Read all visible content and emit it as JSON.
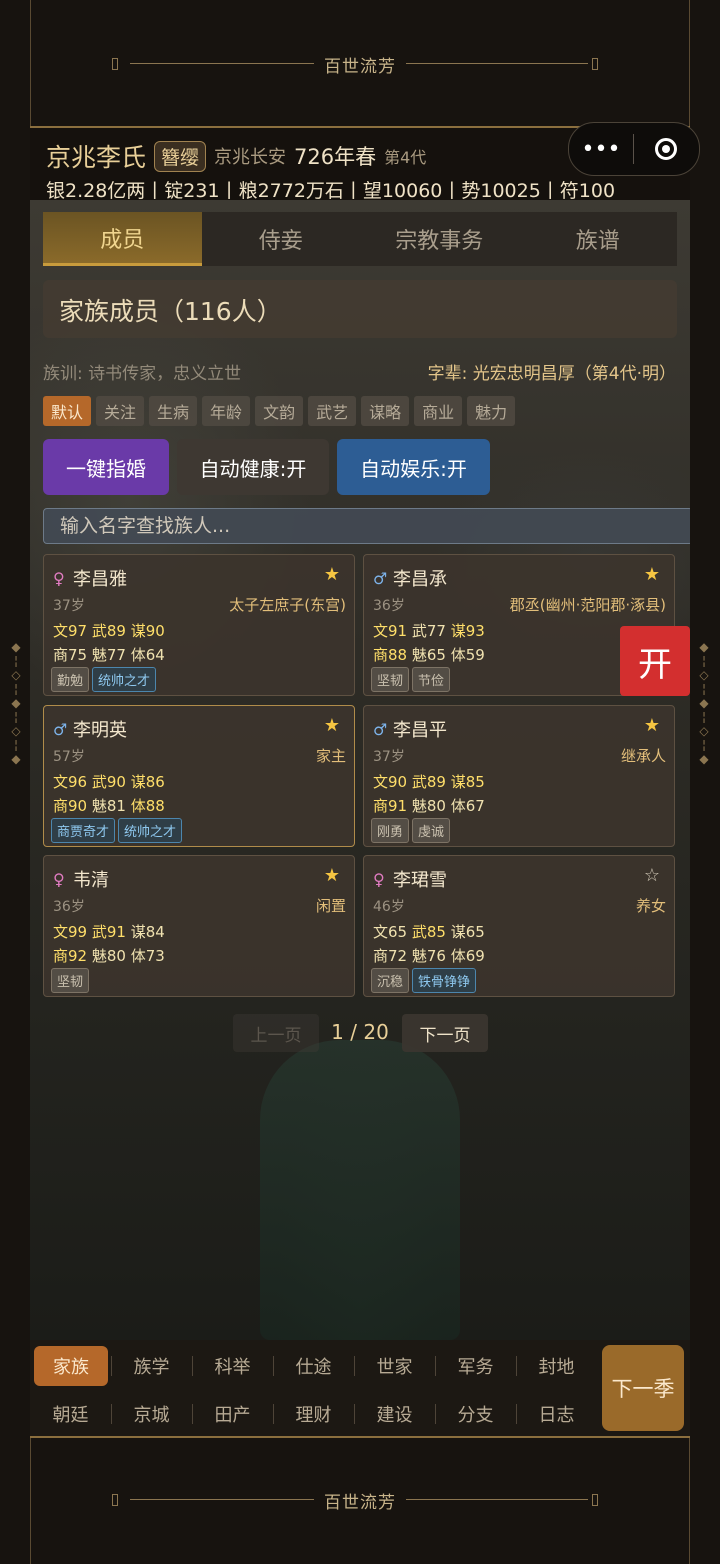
{
  "banner_top": "百世流芳",
  "banner_bottom": "百世流芳",
  "header": {
    "clan": "京兆李氏",
    "rank": "簪缨",
    "place": "京兆长安",
    "year": "726年春",
    "generation": "第4代",
    "resources": "银2.28亿两丨锭231丨粮2772万石丨望10060丨势10025丨符100"
  },
  "capsule": {
    "more_icon": "more-dots-icon",
    "close_icon": "target-icon"
  },
  "tabs": [
    "成员",
    "侍妾",
    "宗教事务",
    "族谱"
  ],
  "section_title": "家族成员（116人）",
  "motto": "族训: 诗书传家，忠义立世",
  "generation_names": "字辈: 光宏忠明昌厚（第4代·明）",
  "sort_chips": [
    "默认",
    "关注",
    "生病",
    "年龄",
    "文韵",
    "武艺",
    "谋略",
    "商业",
    "魅力"
  ],
  "actions": {
    "marry": "一键指婚",
    "health": "自动健康:开",
    "fun": "自动娱乐:开"
  },
  "search_placeholder": "输入名字查找族人...",
  "members": [
    {
      "sex": "♀",
      "name": "李昌雅",
      "star": "★",
      "age": "37岁",
      "role": "太子左庶子(东宫)",
      "wen": "文97",
      "wu": "武89",
      "mou": "谋90",
      "shang": "商75",
      "mei": "魅77",
      "ti": "体64",
      "traits": [
        "勤勉",
        "统帅之才"
      ]
    },
    {
      "sex": "♂",
      "name": "李昌承",
      "star": "★",
      "age": "36岁",
      "role": "郡丞(幽州·范阳郡·涿县)",
      "wen": "文91",
      "wu": "武77",
      "mou": "谋93",
      "shang": "商88",
      "mei": "魅65",
      "ti": "体59",
      "traits": [
        "坚韧",
        "节俭"
      ]
    },
    {
      "sex": "♂",
      "name": "李明英",
      "star": "★",
      "age": "57岁",
      "role": "家主",
      "wen": "文96",
      "wu": "武90",
      "mou": "谋86",
      "shang": "商90",
      "mei": "魅81",
      "ti": "体88",
      "traits": [
        "商贾奇才",
        "统帅之才"
      ]
    },
    {
      "sex": "♂",
      "name": "李昌平",
      "star": "★",
      "age": "37岁",
      "role": "继承人",
      "wen": "文90",
      "wu": "武89",
      "mou": "谋85",
      "shang": "商91",
      "mei": "魅80",
      "ti": "体67",
      "traits": [
        "刚勇",
        "虔诚"
      ]
    },
    {
      "sex": "♀",
      "name": "韦清",
      "star": "★",
      "age": "36岁",
      "role": "闲置",
      "wen": "文99",
      "wu": "武91",
      "mou": "谋84",
      "shang": "商92",
      "mei": "魅80",
      "ti": "体73",
      "traits": [
        "坚韧"
      ]
    },
    {
      "sex": "♀",
      "name": "李珺雪",
      "star": "☆",
      "age": "46岁",
      "role": "养女",
      "wen": "文65",
      "wu": "武85",
      "mou": "谋65",
      "shang": "商72",
      "mei": "魅76",
      "ti": "体69",
      "traits": [
        "沉稳",
        "铁骨铮铮"
      ]
    }
  ],
  "open_button": "开",
  "pager": {
    "prev": "上一页",
    "info": "1 / 20",
    "next": "下一页"
  },
  "bottom_nav": {
    "row1": [
      "家族",
      "族学",
      "科举",
      "仕途",
      "世家",
      "军务",
      "封地"
    ],
    "row2": [
      "朝廷",
      "京城",
      "田产",
      "理财",
      "建设",
      "分支",
      "日志"
    ],
    "next_season": "下一季"
  },
  "colors": {
    "accent": "#b5682a",
    "gold": "#e8cf98",
    "marry": "#6a3aa8",
    "fun": "#2d5d94",
    "open": "#d32f2f"
  }
}
